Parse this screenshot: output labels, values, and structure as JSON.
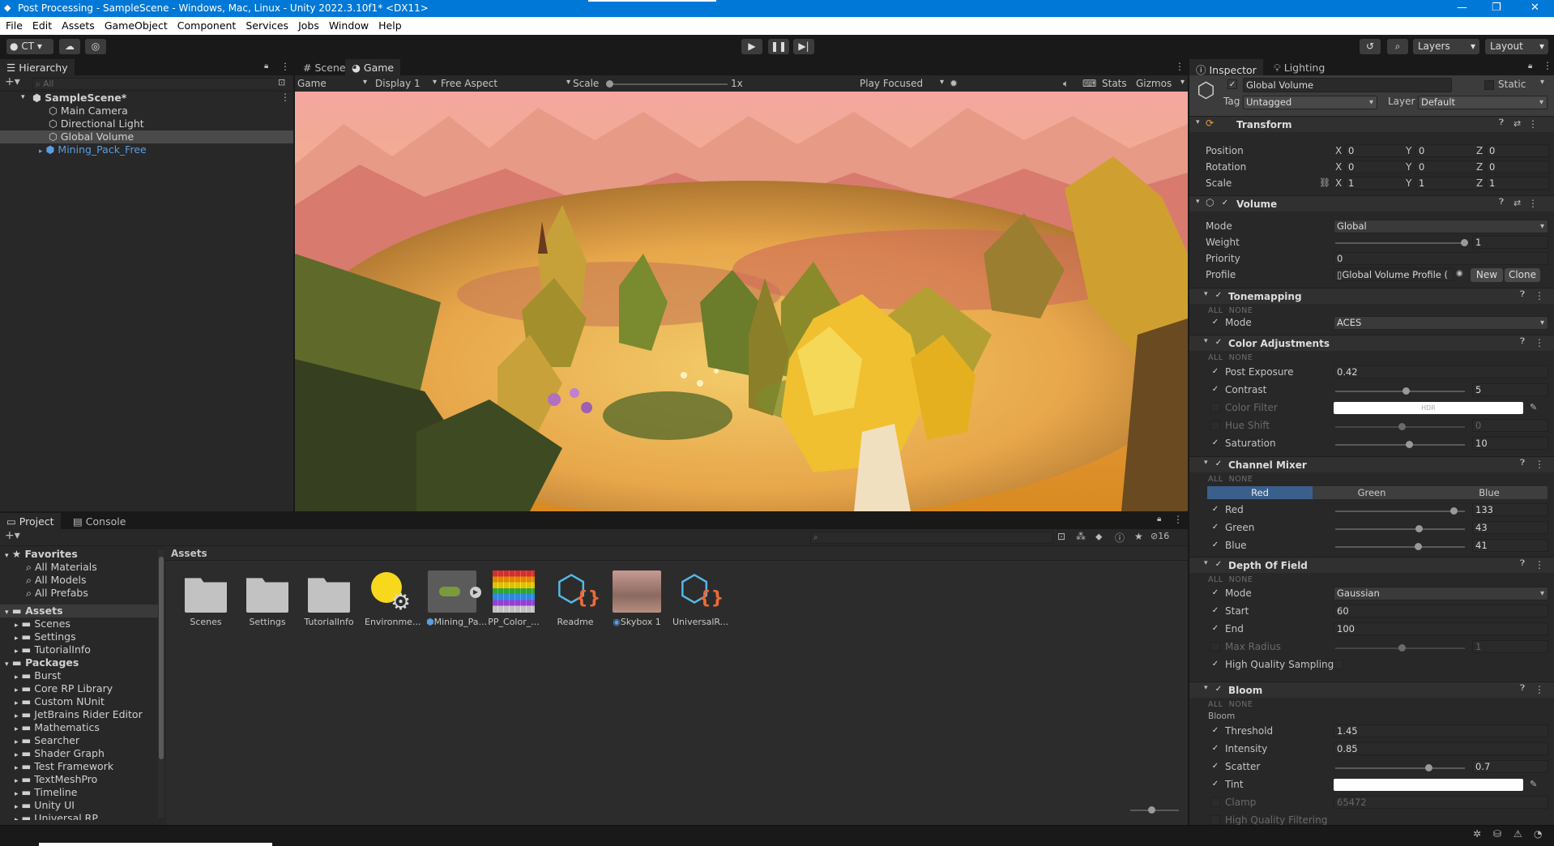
{
  "titlebar": {
    "title": "Post Processing - SampleScene - Windows, Mac, Linux - Unity 2022.3.10f1* <DX11>"
  },
  "menu": [
    "File",
    "Edit",
    "Assets",
    "GameObject",
    "Component",
    "Services",
    "Jobs",
    "Window",
    "Help"
  ],
  "toolbar": {
    "account": "CT",
    "layers": "Layers",
    "layout": "Layout"
  },
  "hierarchy": {
    "tab": "Hierarchy",
    "search_placeholder": "All",
    "scene": "SampleScene*",
    "items": [
      "Main Camera",
      "Directional Light",
      "Global Volume",
      "Mining_Pack_Free"
    ]
  },
  "viewport": {
    "tabs": [
      "Scene",
      "Game"
    ],
    "game_dropdown": "Game",
    "display": "Display 1",
    "aspect": "Free Aspect",
    "scale_label": "Scale",
    "scale_value": "1x",
    "play_mode": "Play Focused",
    "stats": "Stats",
    "gizmos": "Gizmos"
  },
  "project": {
    "tabs": [
      "Project",
      "Console"
    ],
    "favorites_label": "Favorites",
    "favorites": [
      "All Materials",
      "All Models",
      "All Prefabs"
    ],
    "assets_label": "Assets",
    "asset_folders": [
      "Scenes",
      "Settings",
      "TutorialInfo"
    ],
    "packages_label": "Packages",
    "packages": [
      "Burst",
      "Core RP Library",
      "Custom NUnit",
      "JetBrains Rider Editor",
      "Mathematics",
      "Searcher",
      "Shader Graph",
      "Test Framework",
      "TextMeshPro",
      "Timeline",
      "Unity UI",
      "Universal RP"
    ],
    "breadcrumb": "Assets",
    "hidden_count": "16",
    "grid": [
      "Scenes",
      "Settings",
      "TutorialInfo",
      "Environme...",
      "Mining_Pa...",
      "PP_Color_...",
      "Readme",
      "Skybox 1",
      "UniversalR..."
    ]
  },
  "inspector": {
    "tabs": [
      "Inspector",
      "Lighting"
    ],
    "object_name": "Global Volume",
    "static_label": "Static",
    "tag_label": "Tag",
    "tag_value": "Untagged",
    "layer_label": "Layer",
    "layer_value": "Default",
    "transform": {
      "title": "Transform",
      "rows": [
        {
          "label": "Position",
          "x": "0",
          "y": "0",
          "z": "0"
        },
        {
          "label": "Rotation",
          "x": "0",
          "y": "0",
          "z": "0"
        },
        {
          "label": "Scale",
          "x": "1",
          "y": "1",
          "z": "1"
        }
      ]
    },
    "volume": {
      "title": "Volume",
      "mode_label": "Mode",
      "mode_value": "Global",
      "weight_label": "Weight",
      "weight_value": "1",
      "priority_label": "Priority",
      "priority_value": "0",
      "profile_label": "Profile",
      "profile_value": "Global Volume Profile (",
      "new_btn": "New",
      "clone_btn": "Clone"
    },
    "all": "ALL",
    "none": "NONE",
    "tonemapping": {
      "title": "Tonemapping",
      "mode_label": "Mode",
      "mode_value": "ACES"
    },
    "color_adjustments": {
      "title": "Color Adjustments",
      "post_exposure_label": "Post Exposure",
      "post_exposure": "0.42",
      "contrast_label": "Contrast",
      "contrast": "5",
      "color_filter_label": "Color Filter",
      "hdr": "HDR",
      "hue_shift_label": "Hue Shift",
      "hue_shift": "0",
      "saturation_label": "Saturation",
      "saturation": "10"
    },
    "channel_mixer": {
      "title": "Channel Mixer",
      "tabs": [
        "Red",
        "Green",
        "Blue"
      ],
      "red_label": "Red",
      "red": "133",
      "green_label": "Green",
      "green": "43",
      "blue_label": "Blue",
      "blue": "41"
    },
    "dof": {
      "title": "Depth Of Field",
      "mode_label": "Mode",
      "mode_value": "Gaussian",
      "start_label": "Start",
      "start": "60",
      "end_label": "End",
      "end": "100",
      "max_radius_label": "Max Radius",
      "max_radius": "1",
      "hq_label": "High Quality Sampling"
    },
    "bloom": {
      "title": "Bloom",
      "sub": "Bloom",
      "threshold_label": "Threshold",
      "threshold": "1.45",
      "intensity_label": "Intensity",
      "intensity": "0.85",
      "scatter_label": "Scatter",
      "scatter": "0.7",
      "tint_label": "Tint",
      "clamp_label": "Clamp",
      "clamp": "65472",
      "hq_label": "High Quality Filtering"
    }
  }
}
